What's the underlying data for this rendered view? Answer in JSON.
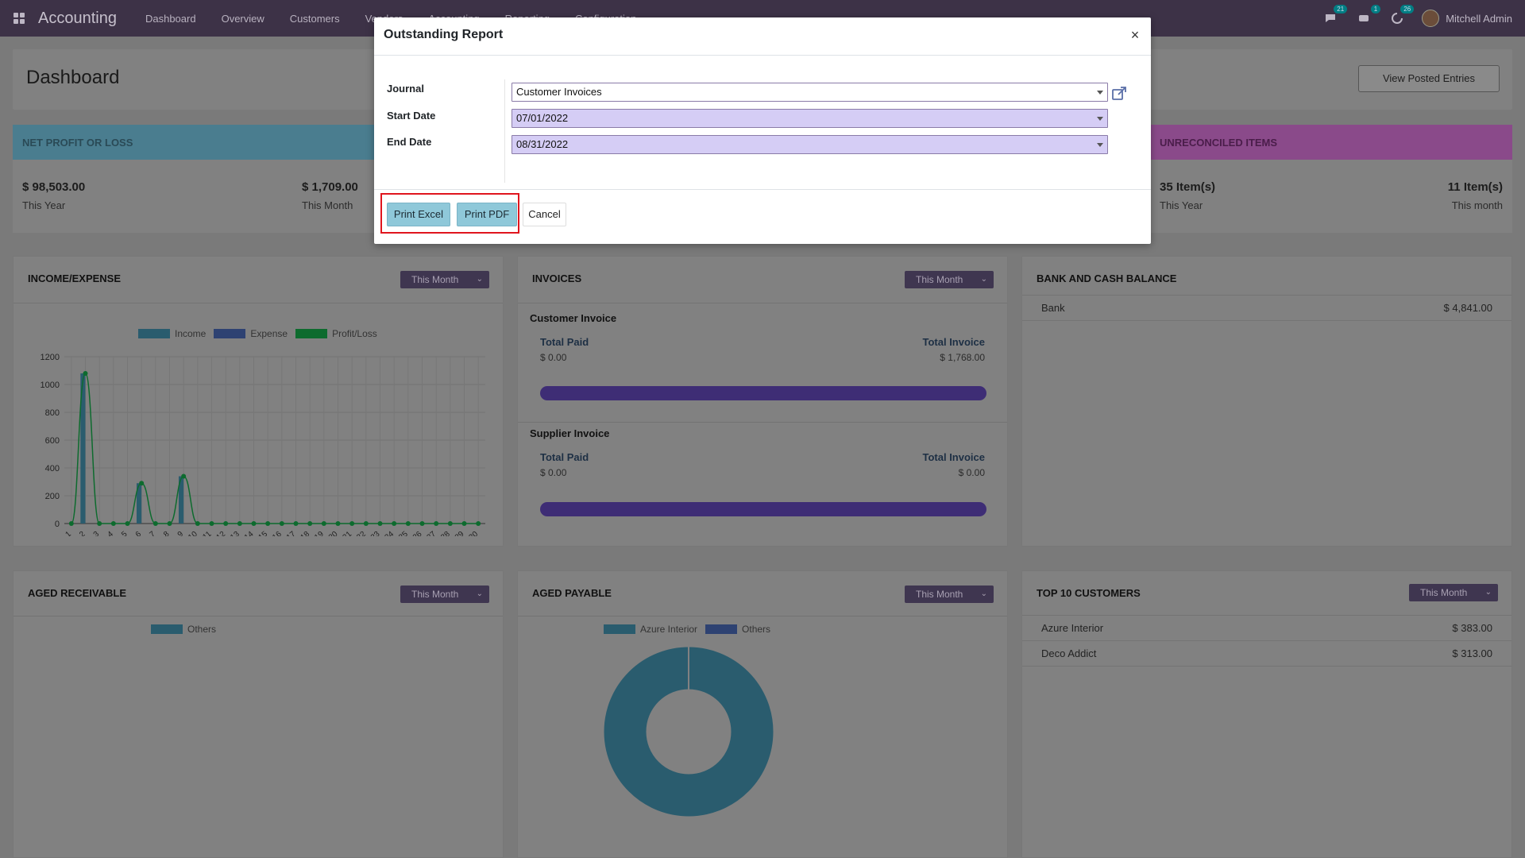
{
  "navbar": {
    "brand": "Accounting",
    "menu": [
      "Dashboard",
      "Overview",
      "Customers",
      "Vendors",
      "Accounting",
      "Reporting",
      "Configuration"
    ],
    "messages_badge": "21",
    "activity_badge": "1",
    "updates_badge": "26",
    "user_name": "Mitchell Admin"
  },
  "control_panel": {
    "title": "Dashboard",
    "view_posted_label": "View Posted Entries"
  },
  "kpis": {
    "net_profit": {
      "title": "NET PROFIT OR LOSS",
      "year_value": "$ 98,503.00",
      "year_label": "This Year",
      "month_value": "$ 1,709.00",
      "month_label": "This Month",
      "color": "#2a5d70"
    },
    "unreconciled": {
      "title": "UNRECONCILED ITEMS",
      "year_value": "35 Item(s)",
      "year_label": "This Year",
      "month_value": "11 Item(s)",
      "month_label": "This month",
      "color": "#6a2a6a"
    }
  },
  "income_expense": {
    "title": "INCOME/EXPENSE",
    "period": "This Month"
  },
  "chart_data": {
    "type": "bar",
    "categories": [
      "1",
      "2",
      "3",
      "4",
      "5",
      "6",
      "7",
      "8",
      "9",
      "10",
      "11",
      "12",
      "13",
      "14",
      "15",
      "16",
      "17",
      "18",
      "19",
      "20",
      "21",
      "22",
      "23",
      "24",
      "25",
      "26",
      "27",
      "28",
      "29",
      "30"
    ],
    "series": [
      {
        "name": "Income",
        "values": [
          0,
          1080,
          0,
          0,
          0,
          290,
          0,
          0,
          340,
          0,
          0,
          0,
          0,
          0,
          0,
          0,
          0,
          0,
          0,
          0,
          0,
          0,
          0,
          0,
          0,
          0,
          0,
          0,
          0,
          0
        ],
        "color": "#2a5c6e"
      },
      {
        "name": "Expense",
        "values": [
          0,
          0,
          0,
          0,
          0,
          0,
          0,
          0,
          0,
          0,
          0,
          0,
          0,
          0,
          0,
          0,
          0,
          0,
          0,
          0,
          0,
          0,
          0,
          0,
          0,
          0,
          0,
          0,
          0,
          0
        ],
        "color": "#2e4272"
      },
      {
        "name": "Profit/Loss",
        "values": [
          0,
          1080,
          0,
          0,
          0,
          290,
          0,
          0,
          340,
          0,
          0,
          0,
          0,
          0,
          0,
          0,
          0,
          0,
          0,
          0,
          0,
          0,
          0,
          0,
          0,
          0,
          0,
          0,
          0,
          0
        ],
        "color": "#0d6b2e"
      }
    ],
    "yticks": [
      "0",
      "200",
      "400",
      "600",
      "800",
      "1000",
      "1200"
    ],
    "ylim": [
      0,
      1200
    ]
  },
  "invoices": {
    "title": "INVOICES",
    "period": "This Month",
    "customer": {
      "heading": "Customer Invoice",
      "paid_label": "Total Paid",
      "paid_value": "$ 0.00",
      "invoice_label": "Total Invoice",
      "invoice_value": "$ 1,768.00",
      "paid_fraction": 1.0
    },
    "supplier": {
      "heading": "Supplier Invoice",
      "paid_label": "Total Paid",
      "paid_value": "$ 0.00",
      "invoice_label": "Total Invoice",
      "invoice_value": "$ 0.00",
      "paid_fraction": 1.0
    }
  },
  "bank_cash": {
    "title": "BANK AND CASH BALANCE",
    "rows": [
      {
        "name": "Bank",
        "amount": "$ 4,841.00"
      }
    ]
  },
  "aged_receivable": {
    "title": "AGED RECEIVABLE",
    "period": "This Month",
    "legend": [
      "Others"
    ]
  },
  "aged_payable": {
    "title": "AGED PAYABLE",
    "period": "This Month",
    "legend": [
      "Azure Interior",
      "Others"
    ],
    "slices": [
      {
        "name": "Azure Interior",
        "value": 100
      },
      {
        "name": "Others",
        "value": 0
      }
    ]
  },
  "top_customers": {
    "title": "TOP 10 CUSTOMERS",
    "period": "This Month",
    "rows": [
      {
        "name": "Azure Interior",
        "amount": "$ 383.00"
      },
      {
        "name": "Deco Addict",
        "amount": "$ 313.00"
      }
    ]
  },
  "modal": {
    "title": "Outstanding Report",
    "close_symbol": "×",
    "journal_label": "Journal",
    "journal_value": "Customer Invoices",
    "start_label": "Start Date",
    "start_value": "07/01/2022",
    "end_label": "End Date",
    "end_value": "08/31/2022",
    "print_excel_label": "Print Excel",
    "print_pdf_label": "Print PDF",
    "cancel_label": "Cancel",
    "highlight_color": "#e0151e"
  }
}
